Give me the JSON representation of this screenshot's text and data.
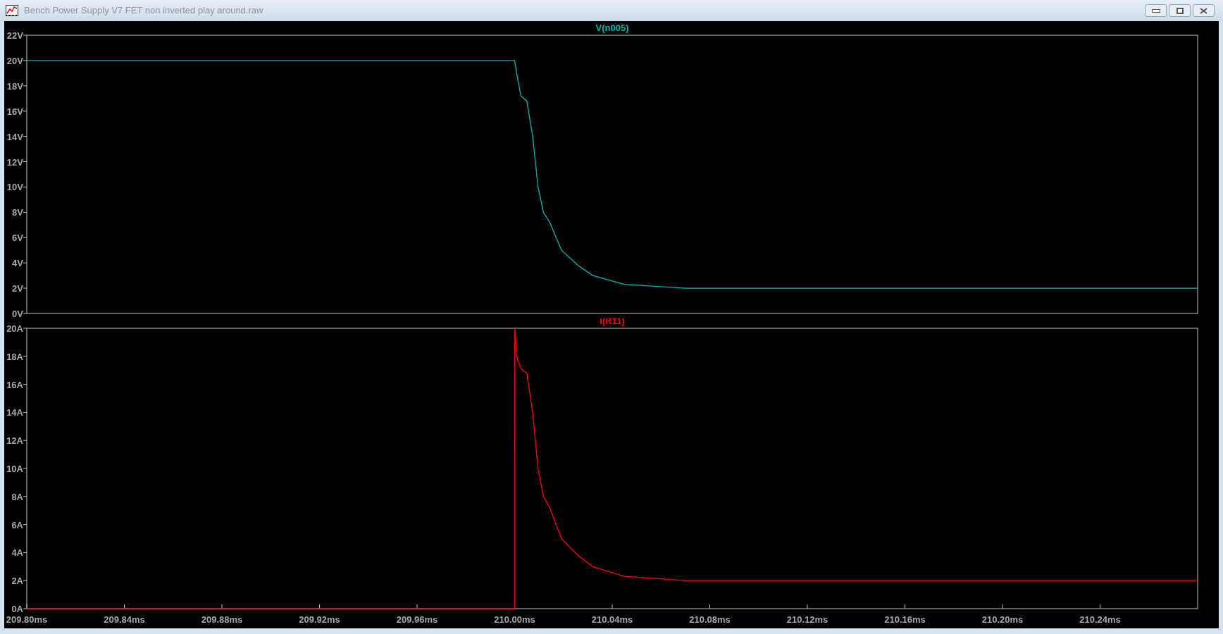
{
  "window": {
    "title": "Bench Power Supply V7 FET non inverted play around.raw"
  },
  "panes": [
    {
      "chart_data": {
        "type": "line",
        "x": [
          209.8,
          210.0,
          210.0008,
          210.0026,
          210.005,
          210.0074,
          210.0096,
          210.0118,
          210.0144,
          210.0192,
          210.026,
          210.032,
          210.045,
          210.07,
          210.28
        ],
        "series": [
          {
            "name": "V(n005)",
            "color": "#00b4b4",
            "values": [
              20,
              20,
              19,
              17.2,
              16.8,
              14,
              10,
              8,
              7.2,
              5,
              3.8,
              3,
              2.3,
              2.0,
              2.0
            ]
          }
        ],
        "xlim": [
          209.8,
          210.28
        ],
        "ylim": [
          0,
          22
        ],
        "yticks": [
          {
            "value": 0,
            "label": "0V"
          },
          {
            "value": 2,
            "label": "2V"
          },
          {
            "value": 4,
            "label": "4V"
          },
          {
            "value": 6,
            "label": "6V"
          },
          {
            "value": 8,
            "label": "8V"
          },
          {
            "value": 10,
            "label": "10V"
          },
          {
            "value": 12,
            "label": "12V"
          },
          {
            "value": 14,
            "label": "14V"
          },
          {
            "value": 16,
            "label": "16V"
          },
          {
            "value": 18,
            "label": "18V"
          },
          {
            "value": 20,
            "label": "20V"
          },
          {
            "value": 22,
            "label": "22V"
          }
        ]
      }
    },
    {
      "chart_data": {
        "type": "line",
        "x": [
          209.8,
          210.0,
          210.0,
          210.0001,
          210.0008,
          210.0026,
          210.005,
          210.0074,
          210.0096,
          210.0118,
          210.0144,
          210.0192,
          210.026,
          210.032,
          210.045,
          210.07,
          210.28
        ],
        "series": [
          {
            "name": "I(R11)",
            "color": "#ff0000",
            "values": [
              0,
              0,
              10,
              20,
              18,
              17.1,
              16.8,
              14,
              10,
              8,
              7.2,
              5,
              3.8,
              3,
              2.3,
              2.0,
              2.0
            ]
          }
        ],
        "xlim": [
          209.8,
          210.28
        ],
        "ylim": [
          0,
          20
        ],
        "xticks": [
          {
            "value": 209.8,
            "label": "209.80ms"
          },
          {
            "value": 209.84,
            "label": "209.84ms"
          },
          {
            "value": 209.88,
            "label": "209.88ms"
          },
          {
            "value": 209.92,
            "label": "209.92ms"
          },
          {
            "value": 209.96,
            "label": "209.96ms"
          },
          {
            "value": 210.0,
            "label": "210.00ms"
          },
          {
            "value": 210.04,
            "label": "210.04ms"
          },
          {
            "value": 210.08,
            "label": "210.08ms"
          },
          {
            "value": 210.12,
            "label": "210.12ms"
          },
          {
            "value": 210.16,
            "label": "210.16ms"
          },
          {
            "value": 210.2,
            "label": "210.20ms"
          },
          {
            "value": 210.24,
            "label": "210.24ms"
          }
        ],
        "yticks": [
          {
            "value": 0,
            "label": "0A"
          },
          {
            "value": 2,
            "label": "2A"
          },
          {
            "value": 4,
            "label": "4A"
          },
          {
            "value": 6,
            "label": "6A"
          },
          {
            "value": 8,
            "label": "8A"
          },
          {
            "value": 10,
            "label": "10A"
          },
          {
            "value": 12,
            "label": "12A"
          },
          {
            "value": 14,
            "label": "14A"
          },
          {
            "value": 16,
            "label": "16A"
          },
          {
            "value": 18,
            "label": "18A"
          },
          {
            "value": 20,
            "label": "20A"
          }
        ]
      }
    }
  ]
}
